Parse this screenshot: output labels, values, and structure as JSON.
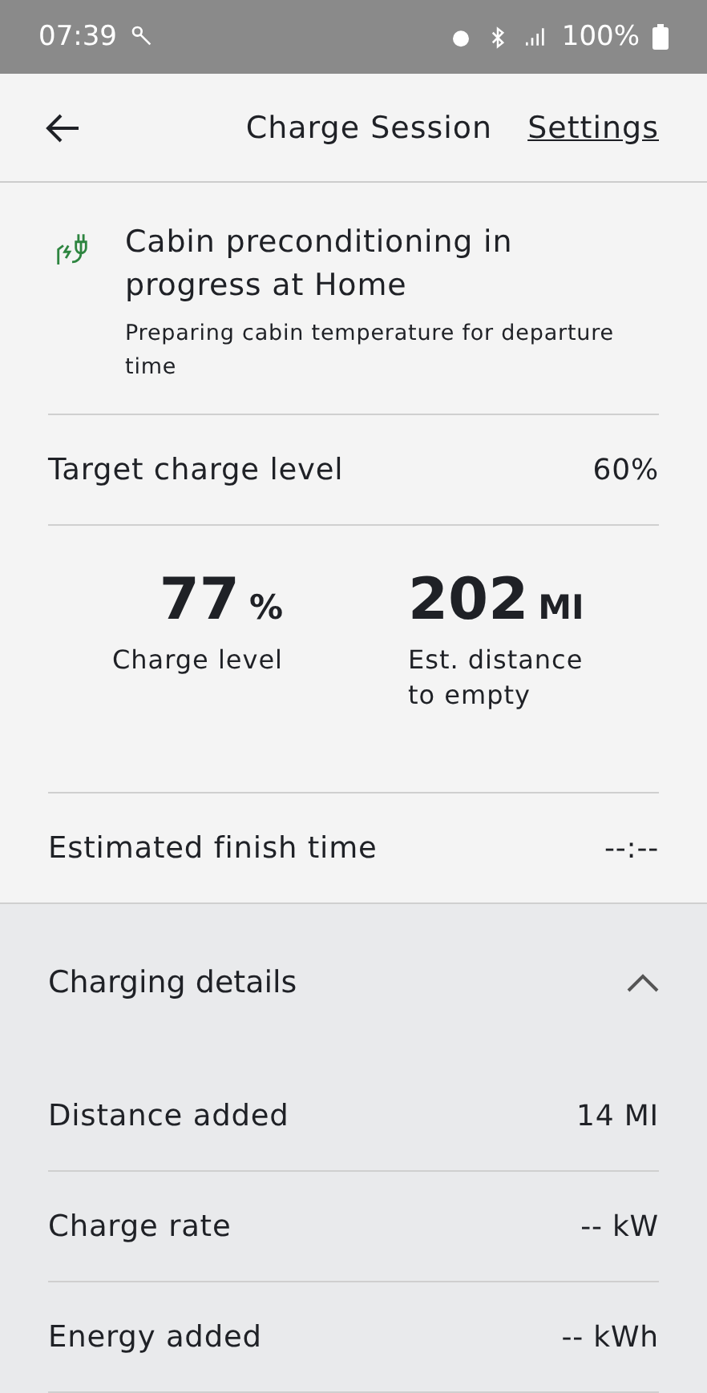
{
  "status_bar": {
    "time": "07:39",
    "battery": "100%"
  },
  "header": {
    "title": "Charge Session",
    "action": "Settings"
  },
  "notice": {
    "title": "Cabin preconditioning in progress at Home",
    "subtitle": "Preparing cabin temperature for departure time"
  },
  "target": {
    "label": "Target charge level",
    "value": "60%"
  },
  "stats": [
    {
      "value": "77",
      "unit": "%",
      "label": "Charge level"
    },
    {
      "value": "202",
      "unit": "MI",
      "label": "Est. distance to empty"
    }
  ],
  "finish": {
    "label": "Estimated finish time",
    "value": "--:--"
  },
  "details": {
    "title": "Charging details",
    "expanded": true,
    "rows": [
      {
        "label": "Distance added",
        "value": "14 MI"
      },
      {
        "label": "Charge rate",
        "value": "-- kW"
      },
      {
        "label": "Energy added",
        "value": "-- kWh"
      }
    ]
  }
}
